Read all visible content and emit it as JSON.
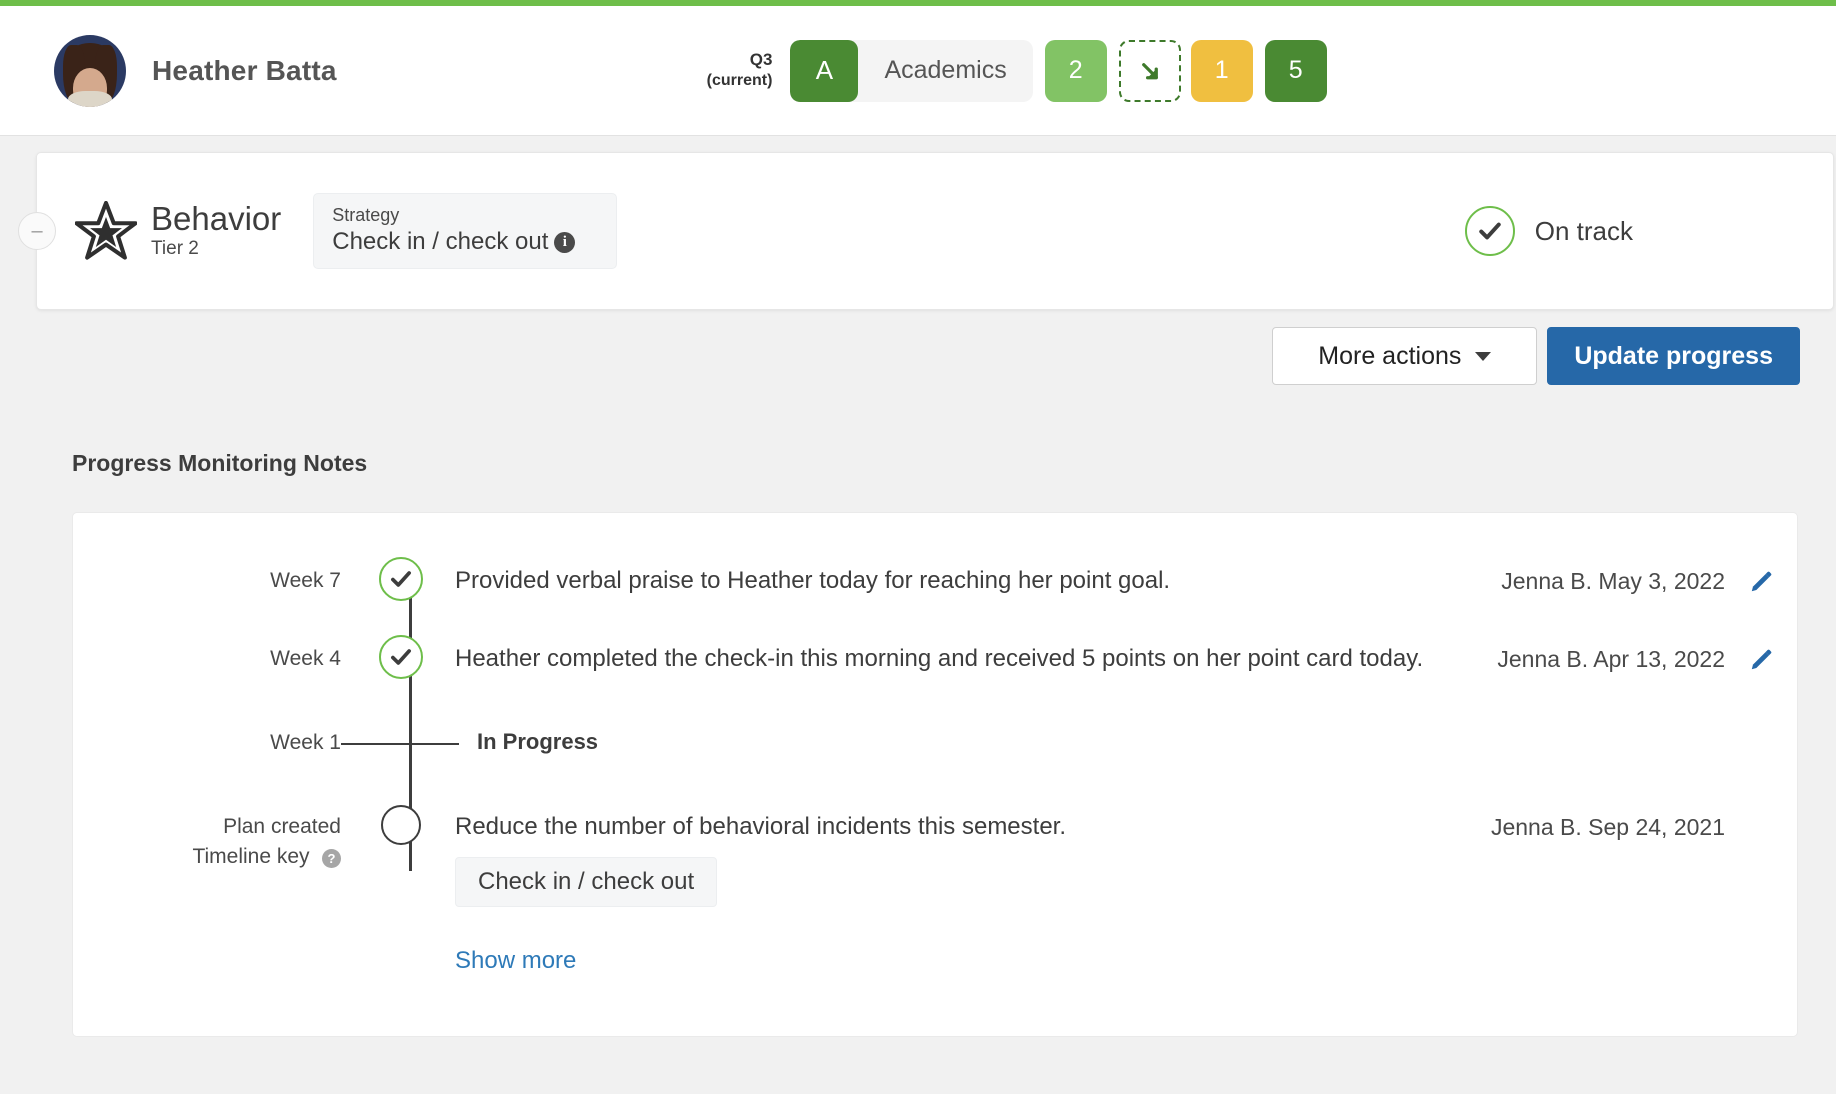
{
  "header": {
    "student_name": "Heather Batta",
    "avatar_alt": "student-avatar",
    "quarter_main": "Q3",
    "quarter_sub": "(current)",
    "subject_grade": "A",
    "subject_label": "Academics",
    "tiles": [
      {
        "value": "2",
        "kind": "green-light"
      },
      {
        "value": "↘",
        "kind": "dashed-arrow"
      },
      {
        "value": "1",
        "kind": "amber"
      },
      {
        "value": "5",
        "kind": "green-dark"
      }
    ]
  },
  "behavior_card": {
    "collapse_label": "–",
    "title": "Behavior",
    "tier": "Tier 2",
    "strategy_label": "Strategy",
    "strategy_value": "Check in / check out",
    "info_glyph": "i",
    "status_text": "On track"
  },
  "toolbar": {
    "more_actions_label": "More actions",
    "update_progress_label": "Update progress"
  },
  "notes": {
    "section_title": "Progress Monitoring Notes",
    "timeline_key_label": "Timeline key",
    "timeline_key_glyph": "?",
    "strategy_chip": "Check in / check out",
    "show_more_label": "Show more",
    "rows": [
      {
        "label": "Week 7",
        "node": "check",
        "text": "Provided verbal praise to Heather today for reaching her point goal.",
        "meta": "Jenna B. May 3, 2022",
        "has_edit": true
      },
      {
        "label": "Week 4",
        "node": "check",
        "text": "Heather completed the check-in this morning and received 5 points on her point card today.",
        "meta": "Jenna B. Apr 13, 2022",
        "has_edit": true
      },
      {
        "label": "Week 1",
        "node": "tick",
        "text": "In Progress",
        "meta": "",
        "has_edit": false
      },
      {
        "label": "Plan created",
        "node": "hollow",
        "text": "Reduce the number of behavioral incidents this semester.",
        "meta": "Jenna B. Sep 24, 2021",
        "has_edit": false
      }
    ]
  },
  "colors": {
    "accent_green": "#6ebe4a",
    "dark_green": "#4a8a33",
    "light_green": "#82c365",
    "amber": "#f0bf40",
    "primary_blue": "#2668a8",
    "link_blue": "#2e7ab8"
  }
}
